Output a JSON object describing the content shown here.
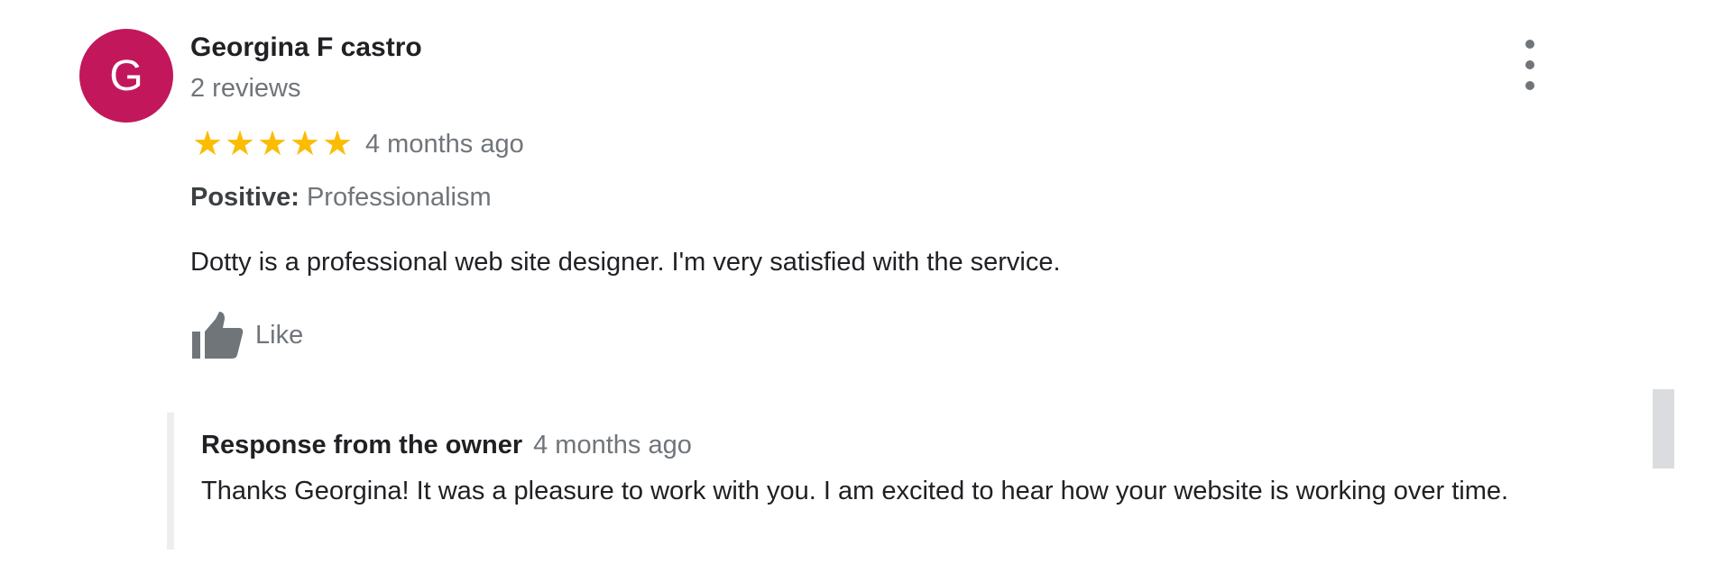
{
  "review": {
    "avatar_initial": "G",
    "author_name": "Georgina F castro",
    "review_count": "2 reviews",
    "rating": 5,
    "rating_max": 5,
    "time_ago": "4 months ago",
    "attribute_label": "Positive:",
    "attribute_value": "Professionalism",
    "text": "Dotty is a professional web site designer. I'm very satisfied with the service.",
    "like_label": "Like"
  },
  "owner_response": {
    "title": "Response from the owner",
    "time_ago": "4 months ago",
    "text": "Thanks Georgina! It was a pleasure to work with you. I am excited to hear how your website is working over time."
  },
  "icons": {
    "more": "more-vert-icon",
    "like": "thumbs-up-icon",
    "star": "star-icon"
  },
  "colors": {
    "avatar_bg": "#c2185b",
    "star": "#fbbc04",
    "muted_text": "#70757a",
    "primary_text": "#202124"
  }
}
